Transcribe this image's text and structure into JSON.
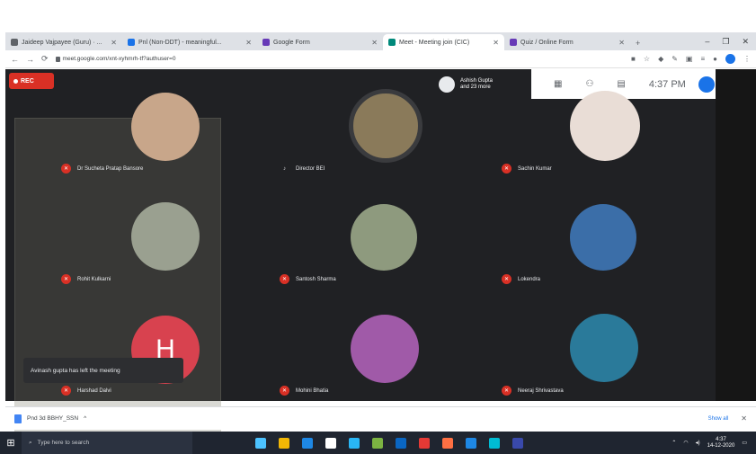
{
  "browser": {
    "tabs": [
      {
        "label": "Jaideep Vajpayee (Guru) · ...",
        "fav": "#5f6368"
      },
      {
        "label": "Pnl (Non-DDT) - meaningful...",
        "fav": "#1a73e8"
      },
      {
        "label": "Google Form",
        "fav": "#673ab7"
      },
      {
        "label": "Meet - Meeting join (CIC)",
        "fav": "#00897b",
        "active": true
      },
      {
        "label": "Quiz / Online Form",
        "fav": "#673ab7"
      }
    ],
    "new_tab": "+",
    "window_controls": [
      "–",
      "❐",
      "✕"
    ],
    "url": "meet.google.com/xnt-xyhmrh-tf?authuser=0"
  },
  "meet": {
    "rec_label": "REC",
    "presenter": {
      "line1": "Ashish Gupta",
      "line2": "and 23 more"
    },
    "time": "4:37 PM",
    "participants": [
      {
        "name": "Dr Sucheta Pratap Bansore",
        "color": "#c8a68a",
        "muted": true
      },
      {
        "name": "Director BEI",
        "color": "#8a7a5a",
        "muted": false
      },
      {
        "name": "Sachin Kumar",
        "color": "#e9ddd6",
        "muted": true
      },
      {
        "name": "Rohit Kulkarni",
        "color": "#9aa090",
        "muted": true
      },
      {
        "name": "Santosh Sharma",
        "color": "#8e9a7e",
        "muted": true
      },
      {
        "name": "Lokendra",
        "color": "#3b6ea8",
        "muted": true
      },
      {
        "name": "Harshad Dalvi",
        "color": "#d8424f",
        "letter": "H",
        "muted": true
      },
      {
        "name": "Mohini Bhatia",
        "color": "#a05aa8",
        "muted": true
      },
      {
        "name": "Neeraj Shrivastava",
        "color": "#2a7a9a",
        "muted": true
      }
    ],
    "toast": "Avinash gupta has left the meeting"
  },
  "downloads": {
    "file": "Pnd 3d BBHY_SSN",
    "chevron": "^",
    "show_all": "Show all",
    "close": "✕"
  },
  "taskbar": {
    "start": "⊞",
    "search_placeholder": "Type here to search",
    "apps": [
      "#4cc2ff",
      "#f2b705",
      "#1e88e5",
      "#ffffff",
      "#29b6f6",
      "#7cb342",
      "#0a66c2",
      "#e53935",
      "#ff7043",
      "#1e88e5",
      "#00bcd4",
      "#3949ab"
    ],
    "tray_lang": "ENG\nIN",
    "clock_time": "4:37",
    "clock_date": "14-12-2020"
  }
}
